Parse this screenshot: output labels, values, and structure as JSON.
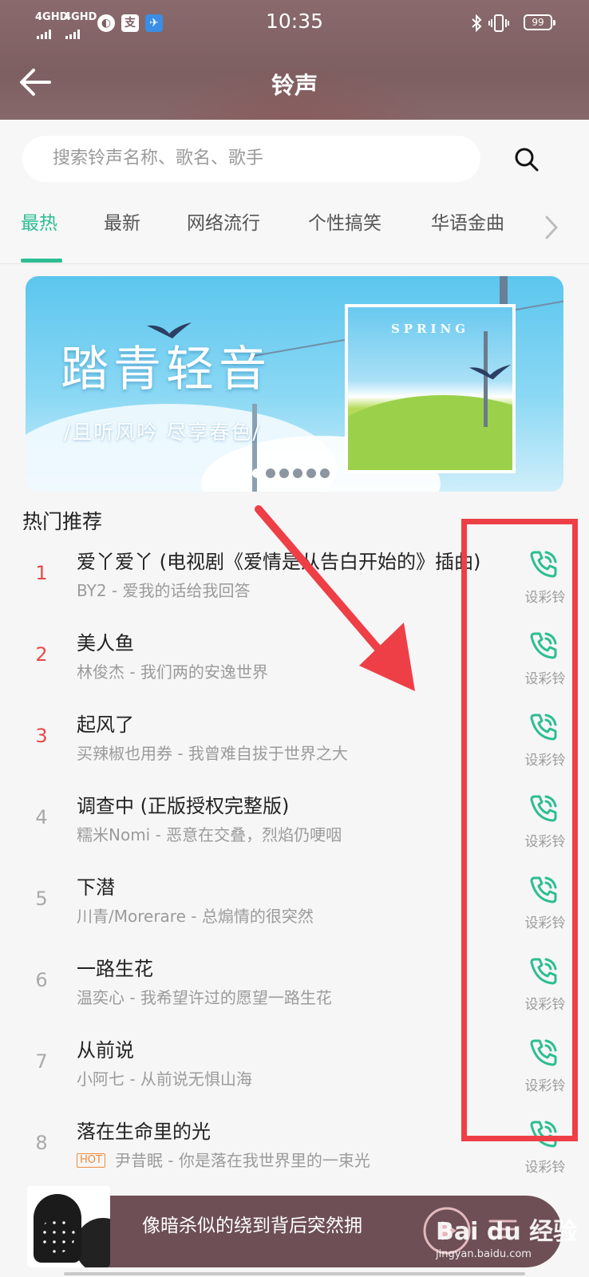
{
  "status_bar": {
    "signal1": "4GHD",
    "signal2": "4GHD",
    "time": "10:35",
    "battery": "99"
  },
  "header": {
    "title": "铃声"
  },
  "search": {
    "placeholder": "搜索铃声名称、歌名、歌手"
  },
  "tabs": [
    {
      "label": "最热",
      "active": true
    },
    {
      "label": "最新"
    },
    {
      "label": "网络流行"
    },
    {
      "label": "个性搞笑"
    },
    {
      "label": "华语金曲"
    }
  ],
  "banner": {
    "title": "踏青轻音",
    "subtitle": "/且听风吟 尽享春色/",
    "art_label": "SPRING",
    "dot_count": 6,
    "active_dot": 0
  },
  "section": {
    "title": "热门推荐"
  },
  "songs": [
    {
      "rank": "1",
      "title": "爱丫爱丫 (电视剧《爱情是从告白开始的》插曲)",
      "artist_line": "BY2 - 爱我的话给我回答",
      "action": "设彩铃"
    },
    {
      "rank": "2",
      "title": "美人鱼",
      "artist_line": "林俊杰 - 我们两的安逸世界",
      "action": "设彩铃"
    },
    {
      "rank": "3",
      "title": "起风了",
      "artist_line": "买辣椒也用券 - 我曾难自拔于世界之大",
      "action": "设彩铃"
    },
    {
      "rank": "4",
      "title": "调查中 (正版授权完整版)",
      "artist_line": "糯米Nomi - 恶意在交叠，烈焰仍哽咽",
      "action": "设彩铃"
    },
    {
      "rank": "5",
      "title": "下潜",
      "artist_line": "川青/Morerare - 总煽情的很突然",
      "action": "设彩铃"
    },
    {
      "rank": "6",
      "title": "一路生花",
      "artist_line": "温奕心 - 我希望许过的愿望一路生花",
      "action": "设彩铃"
    },
    {
      "rank": "7",
      "title": "从前说",
      "artist_line": "小阿七 - 从前说无惧山海",
      "action": "设彩铃"
    },
    {
      "rank": "8",
      "title": "落在生命里的光",
      "tag": "HOT",
      "artist_line": "尹昔眠 - 你是落在我世界里的一束光",
      "action": "设彩铃"
    }
  ],
  "player": {
    "lyric": "像暗杀似的绕到背后突然拥"
  },
  "watermark": {
    "text": "Bai du 经验",
    "url": "jingyan.baidu.com"
  },
  "colors": {
    "accent": "#2dbe92",
    "hot_rank": "#e84a4a",
    "annotation": "#ee3f47",
    "header_bg": "#7e5f61"
  }
}
